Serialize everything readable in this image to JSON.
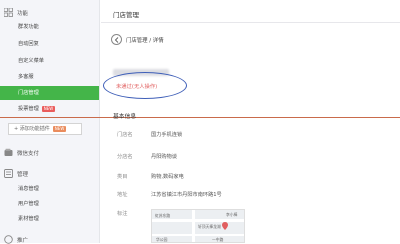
{
  "sidebar": {
    "group_function": "功能",
    "items_function": [
      {
        "label": "群发功能"
      },
      {
        "label": "自动回复"
      },
      {
        "label": "自定义菜单"
      },
      {
        "label": "多客服"
      },
      {
        "label": "门店管理",
        "active": true
      },
      {
        "label": "投票管理",
        "badge": "NEW"
      }
    ],
    "add_plugin": "添加功能插件",
    "add_plugin_badge": "NEW",
    "group_wechat_pay": "微信支付",
    "group_manage": "管理",
    "items_manage": [
      {
        "label": "消息管理"
      },
      {
        "label": "用户管理"
      },
      {
        "label": "素材管理"
      }
    ],
    "group_next": "推广"
  },
  "main": {
    "page_title": "门店管理",
    "breadcrumb": "门店管理 / 详情",
    "status": "未通过(无人操作)",
    "section_title": "基本信息",
    "rows": [
      {
        "label": "门店名",
        "value": "国力手机连锁"
      },
      {
        "label": "分店名",
        "value": "丹阳购物谈"
      },
      {
        "label": "类目",
        "value": "购物,数码家电"
      },
      {
        "label": "地址",
        "value": "江苏省镇江市丹阳市南环路1号"
      },
      {
        "label": "标注",
        "value": ""
      }
    ],
    "map_labels": [
      "虹苏东路",
      "轩顶天棒龙湖",
      "华公园",
      "一中路",
      "李小棒"
    ]
  },
  "colors": {
    "accent": "#44b549",
    "status_red": "#e15f5f",
    "highlight_ellipse": "#3f5fb8"
  }
}
